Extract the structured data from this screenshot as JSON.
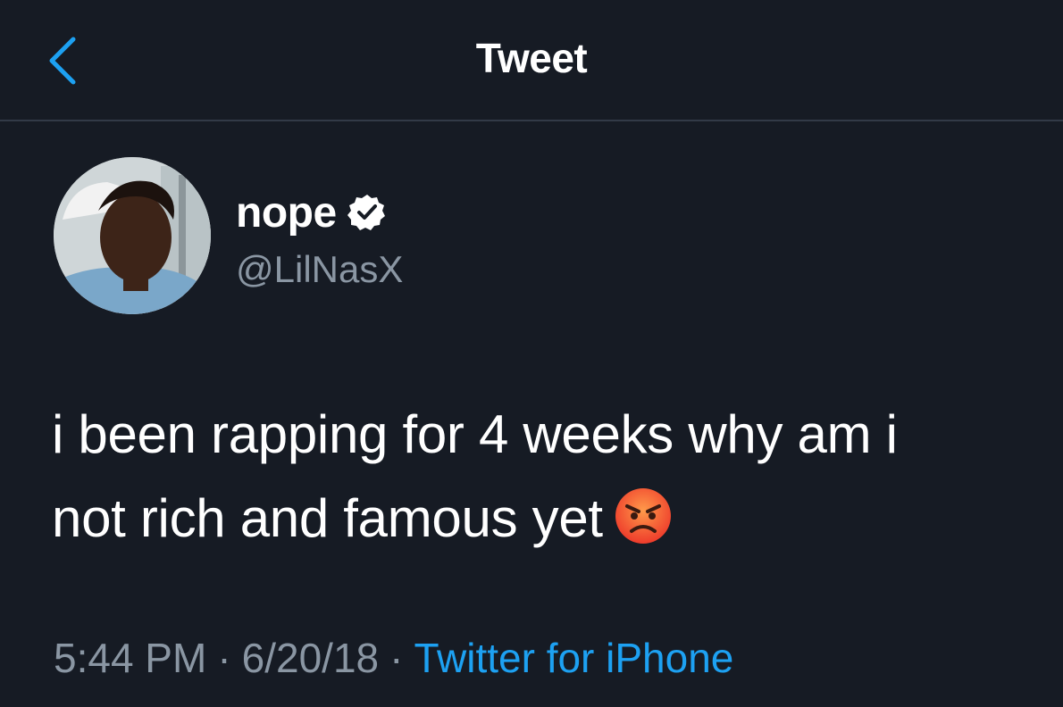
{
  "header": {
    "title": "Tweet",
    "back_icon": "chevron-left-icon"
  },
  "author": {
    "display_name": "nope",
    "verified_icon": "verified-badge-icon",
    "handle": "@LilNasX"
  },
  "tweet": {
    "line1": "i been rapping for 4 weeks why am i",
    "line2": "not rich and famous yet",
    "emoji": "angry-face-icon"
  },
  "meta": {
    "time": "5:44 PM",
    "separator": "·",
    "date": "6/20/18",
    "source": "Twitter for iPhone"
  },
  "colors": {
    "background": "#161b24",
    "divider": "#323a47",
    "text": "#ffffff",
    "secondary_text": "#8a96a3",
    "accent": "#1da1f2"
  }
}
